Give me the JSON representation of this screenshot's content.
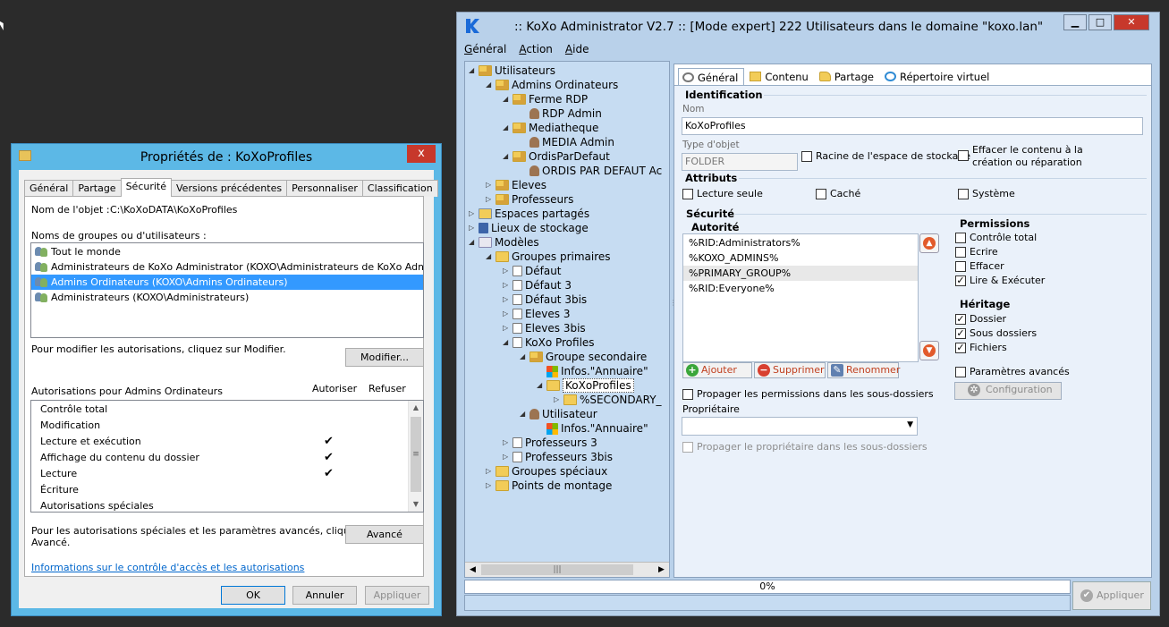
{
  "props_dialog": {
    "title": "Propriétés de : KoXoProfiles",
    "close": "x",
    "tabs": [
      "Général",
      "Partage",
      "Sécurité",
      "Versions précédentes",
      "Personnaliser",
      "Classification"
    ],
    "active_tab": "Sécurité",
    "object_name_label": "Nom de l'objet :",
    "object_name_value": "C:\\KoXoDATA\\KoXoProfiles",
    "groups_label": "Noms de groupes ou d'utilisateurs :",
    "groups": [
      "Tout le monde",
      "Administrateurs de KoXo Administrator (KOXO\\Administrateurs de KoXo Administrator)",
      "Admins Ordinateurs (KOXO\\Admins Ordinateurs)",
      "Administrateurs (KOXO\\Administrateurs)"
    ],
    "selected_group_index": 2,
    "modify_text": "Pour modifier les autorisations, cliquez sur Modifier.",
    "modify_button": "Modifier...",
    "permissions_for": "Autorisations pour Admins Ordinateurs",
    "allow_header": "Autoriser",
    "deny_header": "Refuser",
    "permissions": [
      {
        "name": "Contrôle total",
        "allow": false
      },
      {
        "name": "Modification",
        "allow": false
      },
      {
        "name": "Lecture et exécution",
        "allow": true
      },
      {
        "name": "Affichage du contenu du dossier",
        "allow": true
      },
      {
        "name": "Lecture",
        "allow": true
      },
      {
        "name": "Écriture",
        "allow": false
      },
      {
        "name": "Autorisations spéciales",
        "allow": false
      }
    ],
    "check_glyph": "✔",
    "advanced_text_1": "Pour les autorisations spéciales et les paramètres avancés, cliquez sur",
    "advanced_text_2": "Avancé.",
    "advanced_button": "Avancé",
    "info_link": "Informations sur le contrôle d'accès et les autorisations",
    "ok": "OK",
    "cancel": "Annuler",
    "apply": "Appliquer"
  },
  "koxo": {
    "title": ":: KoXo Administrator V2.7 :: [Mode expert] 222 Utilisateurs dans le domaine \"koxo.lan\"",
    "window_buttons": [
      "▁",
      "□",
      "✕"
    ],
    "menu": [
      {
        "u": "G",
        "rest": "énéral"
      },
      {
        "u": "A",
        "rest": "ction"
      },
      {
        "u": "A",
        "rest": "ide"
      }
    ],
    "tree": [
      {
        "label": "Utilisateurs",
        "level": 0,
        "exp": "◢",
        "icon": "folder-users"
      },
      {
        "label": "Admins Ordinateurs",
        "level": 1,
        "exp": "◢",
        "icon": "folder-users"
      },
      {
        "label": "Ferme RDP",
        "level": 2,
        "exp": "◢",
        "icon": "folder-users"
      },
      {
        "label": "RDP Admin",
        "level": 3,
        "exp": "",
        "icon": "user"
      },
      {
        "label": "Mediatheque",
        "level": 2,
        "exp": "◢",
        "icon": "folder-users"
      },
      {
        "label": "MEDIA Admin",
        "level": 3,
        "exp": "",
        "icon": "user"
      },
      {
        "label": "OrdisParDefaut",
        "level": 2,
        "exp": "◢",
        "icon": "folder-users"
      },
      {
        "label": "ORDIS PAR DEFAUT Ac",
        "level": 3,
        "exp": "",
        "icon": "user"
      },
      {
        "label": "Eleves",
        "level": 1,
        "exp": "▷",
        "icon": "folder-users"
      },
      {
        "label": "Professeurs",
        "level": 1,
        "exp": "▷",
        "icon": "folder-users"
      },
      {
        "label": "Espaces partagés",
        "level": 0,
        "exp": "▷",
        "icon": "share"
      },
      {
        "label": "Lieux de stockage",
        "level": 0,
        "exp": "▷",
        "icon": "storage"
      },
      {
        "label": "Modèles",
        "level": 0,
        "exp": "◢",
        "icon": "models"
      },
      {
        "label": "Groupes primaires",
        "level": 1,
        "exp": "◢",
        "icon": "folder"
      },
      {
        "label": "Défaut",
        "level": 2,
        "exp": "▷",
        "icon": "page"
      },
      {
        "label": "Défaut 3",
        "level": 2,
        "exp": "▷",
        "icon": "page"
      },
      {
        "label": "Défaut 3bis",
        "level": 2,
        "exp": "▷",
        "icon": "page"
      },
      {
        "label": "Eleves 3",
        "level": 2,
        "exp": "▷",
        "icon": "page"
      },
      {
        "label": "Eleves 3bis",
        "level": 2,
        "exp": "▷",
        "icon": "page"
      },
      {
        "label": "KoXo Profiles",
        "level": 2,
        "exp": "◢",
        "icon": "page"
      },
      {
        "label": "Groupe secondaire",
        "level": 3,
        "exp": "◢",
        "icon": "folder-users"
      },
      {
        "label": "Infos.\"Annuaire\"",
        "level": 4,
        "exp": "",
        "icon": "win"
      },
      {
        "label": "KoXoProfiles",
        "level": 4,
        "exp": "◢",
        "icon": "folder",
        "selected": true
      },
      {
        "label": "%SECONDARY_",
        "level": 5,
        "exp": "▷",
        "icon": "folder"
      },
      {
        "label": "Utilisateur",
        "level": 3,
        "exp": "◢",
        "icon": "user"
      },
      {
        "label": "Infos.\"Annuaire\"",
        "level": 4,
        "exp": "",
        "icon": "win"
      },
      {
        "label": "Professeurs 3",
        "level": 2,
        "exp": "▷",
        "icon": "page"
      },
      {
        "label": "Professeurs 3bis",
        "level": 2,
        "exp": "▷",
        "icon": "page"
      },
      {
        "label": "Groupes spéciaux",
        "level": 1,
        "exp": "▷",
        "icon": "folder"
      },
      {
        "label": "Points de montage",
        "level": 1,
        "exp": "▷",
        "icon": "folder"
      }
    ],
    "tabs": [
      {
        "label": "Général",
        "icon": "gear"
      },
      {
        "label": "Contenu",
        "icon": "folder"
      },
      {
        "label": "Partage",
        "icon": "share"
      },
      {
        "label": "Répertoire virtuel",
        "icon": "ie"
      }
    ],
    "identification": {
      "title": "Identification",
      "name_label": "Nom",
      "name_value": "KoXoProfiles",
      "type_label": "Type d'objet",
      "type_value": "FOLDER",
      "racine": "Racine de l'espace de stockage",
      "effacer_1": "Effacer le contenu à la",
      "effacer_2": "création ou réparation"
    },
    "attributs": {
      "title": "Attributs",
      "items": [
        "Lecture seule",
        "Caché",
        "Système"
      ]
    },
    "securite": {
      "title": "Sécurité",
      "autorite_label": "Autorité",
      "authorities": [
        "%RID:Administrators%",
        "%KOXO_ADMINS%",
        "%PRIMARY_GROUP%",
        "%RID:Everyone%"
      ],
      "highlighted_index": 2,
      "add": "Ajouter",
      "remove": "Supprimer",
      "rename": "Renommer",
      "propagate_perms": "Propager les permissions dans les sous-dossiers",
      "owner_label": "Propriétaire",
      "owner_value": "",
      "propagate_owner": "Propager le propriétaire dans les sous-dossiers",
      "permissions_title": "Permissions",
      "permissions": [
        {
          "label": "Contrôle total",
          "checked": false
        },
        {
          "label": "Ecrire",
          "checked": false
        },
        {
          "label": "Effacer",
          "checked": false
        },
        {
          "label": "Lire & Exécuter",
          "checked": true
        }
      ],
      "heritage_title": "Héritage",
      "heritage": [
        {
          "label": "Dossier",
          "checked": true
        },
        {
          "label": "Sous dossiers",
          "checked": true
        },
        {
          "label": "Fichiers",
          "checked": true
        }
      ],
      "advanced_params": "Paramètres avancés",
      "config_button": "Configuration"
    },
    "progress": "0%",
    "apply": "Appliquer"
  }
}
